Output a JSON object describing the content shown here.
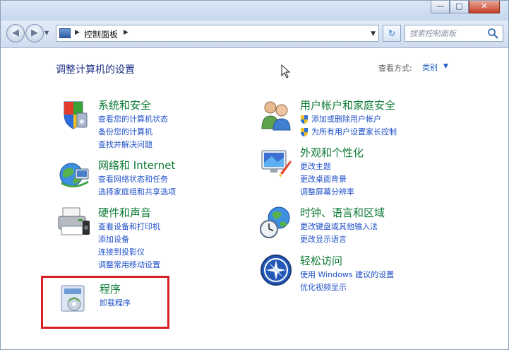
{
  "window": {
    "controls": {
      "minimize": "—",
      "maximize": "□",
      "close": "✕"
    }
  },
  "nav": {
    "back_icon": "◀",
    "forward_icon": "▶",
    "breadcrumb": "控制面板",
    "search_placeholder": "搜索控制面板"
  },
  "header": {
    "title": "调整计算机的设置",
    "view_by_label": "查看方式:",
    "view_by_value": "类别"
  },
  "categories": [
    {
      "title": "系统和安全",
      "icon": "shield-icon",
      "links": [
        "查看您的计算机状态",
        "备份您的计算机",
        "查找并解决问题"
      ]
    },
    {
      "title": "网络和 Internet",
      "icon": "network-globe-icon",
      "links": [
        "查看网络状态和任务",
        "选择家庭组和共享选项"
      ]
    },
    {
      "title": "硬件和声音",
      "icon": "printer-icon",
      "links": [
        "查看设备和打印机",
        "添加设备",
        "连接到投影仪",
        "调整常用移动设置"
      ]
    },
    {
      "title": "程序",
      "icon": "programs-icon",
      "links": [
        "卸载程序"
      ]
    },
    {
      "title": "用户帐户和家庭安全",
      "icon": "users-icon",
      "links": [
        "添加或删除用户帐户",
        "为所有用户设置家长控制"
      ]
    },
    {
      "title": "外观和个性化",
      "icon": "appearance-icon",
      "links": [
        "更改主题",
        "更改桌面背景",
        "调整屏幕分辨率"
      ]
    },
    {
      "title": "时钟、语言和区域",
      "icon": "clock-globe-icon",
      "links": [
        "更改键盘或其他输入法",
        "更改显示语言"
      ]
    },
    {
      "title": "轻松访问",
      "icon": "ease-of-access-icon",
      "links": [
        "使用 Windows 建议的设置",
        "优化视频显示"
      ]
    }
  ],
  "colors": {
    "category_title": "#0c7a36",
    "link": "#1f4fc9",
    "page_title": "#1e3287",
    "highlight": "#d71f26"
  }
}
